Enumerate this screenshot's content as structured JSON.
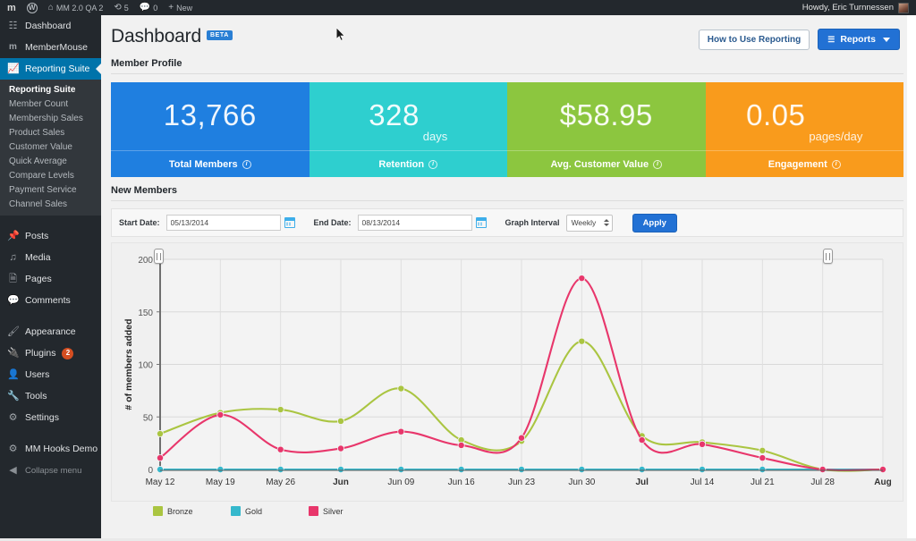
{
  "adminbar": {
    "logo": "m",
    "wp_icon": "wordpress-icon",
    "site_name": "MM 2.0 QA 2",
    "updates_count": "5",
    "comments_count": "0",
    "new_label": "New",
    "howdy": "Howdy, Eric Turnnessen"
  },
  "sidebar": {
    "items": [
      {
        "label": "Dashboard",
        "icon": "dashboard-icon",
        "active": false
      },
      {
        "label": "MemberMouse",
        "icon": "membermouse-icon",
        "active": false
      },
      {
        "label": "Reporting Suite",
        "icon": "chart-bar-icon",
        "active": true
      }
    ],
    "submenu": [
      {
        "label": "Reporting Suite",
        "current": true
      },
      {
        "label": "Member Count",
        "current": false
      },
      {
        "label": "Membership Sales",
        "current": false
      },
      {
        "label": "Product Sales",
        "current": false
      },
      {
        "label": "Customer Value",
        "current": false
      },
      {
        "label": "Quick Average",
        "current": false
      },
      {
        "label": "Compare Levels",
        "current": false
      },
      {
        "label": "Payment Service",
        "current": false
      },
      {
        "label": "Channel Sales",
        "current": false
      }
    ],
    "group2": [
      {
        "label": "Posts",
        "icon": "pin-icon"
      },
      {
        "label": "Media",
        "icon": "media-icon"
      },
      {
        "label": "Pages",
        "icon": "pages-icon"
      },
      {
        "label": "Comments",
        "icon": "comment-icon"
      }
    ],
    "group3": [
      {
        "label": "Appearance",
        "icon": "brush-icon",
        "badge": ""
      },
      {
        "label": "Plugins",
        "icon": "plug-icon",
        "badge": "2"
      },
      {
        "label": "Users",
        "icon": "users-icon",
        "badge": ""
      },
      {
        "label": "Tools",
        "icon": "wrench-icon",
        "badge": ""
      },
      {
        "label": "Settings",
        "icon": "settings-icon",
        "badge": ""
      }
    ],
    "group4": [
      {
        "label": "MM Hooks Demo",
        "icon": "gear-icon"
      }
    ],
    "collapse": {
      "label": "Collapse menu",
      "icon": "collapse-icon"
    }
  },
  "header": {
    "title": "Dashboard",
    "badge": "BETA",
    "how_to_button": "How to Use Reporting",
    "reports_button": "Reports"
  },
  "member_profile": {
    "section_title": "Member Profile",
    "tiles": [
      {
        "value": "13,766",
        "unit": "",
        "label": "Total Members",
        "color": "#1f7fe0"
      },
      {
        "value": "328",
        "unit": "days",
        "label": "Retention",
        "color": "#2ecfcf"
      },
      {
        "value": "$58.95",
        "unit": "",
        "label": "Avg. Customer Value",
        "color": "#8cc63f"
      },
      {
        "value": "0.05",
        "unit": "pages/day",
        "label": "Engagement",
        "color": "#f99b1c"
      }
    ]
  },
  "new_members": {
    "section_title": "New Members",
    "start_date_label": "Start Date:",
    "start_date_value": "05/13/2014",
    "end_date_label": "End Date:",
    "end_date_value": "08/13/2014",
    "graph_interval_label": "Graph Interval",
    "graph_interval_value": "Weekly",
    "apply_label": "Apply"
  },
  "chart_data": {
    "type": "line",
    "title": "New Members",
    "xlabel": "",
    "ylabel": "# of members added",
    "ylim": [
      0,
      200
    ],
    "yticks": [
      0,
      50,
      100,
      150,
      200
    ],
    "grid": true,
    "legend_position": "bottom-left",
    "categories": [
      "May 12",
      "May 19",
      "May 26",
      "Jun",
      "Jun 09",
      "Jun 16",
      "Jun 23",
      "Jun 30",
      "Jul",
      "Jul 14",
      "Jul 21",
      "Jul 28",
      "Aug"
    ],
    "bold_categories": [
      "Jun",
      "Jul",
      "Aug"
    ],
    "series": [
      {
        "name": "Bronze",
        "color": "#aac541",
        "values": [
          34,
          54,
          57,
          46,
          77,
          28,
          27,
          122,
          32,
          26,
          18,
          0,
          0
        ]
      },
      {
        "name": "Gold",
        "color": "#35b8cc",
        "values": [
          0,
          0,
          0,
          0,
          0,
          0,
          0,
          0,
          0,
          0,
          0,
          0,
          0
        ]
      },
      {
        "name": "Silver",
        "color": "#e8366b",
        "values": [
          11,
          52,
          19,
          20,
          36,
          23,
          30,
          182,
          28,
          24,
          11,
          0,
          0
        ]
      }
    ]
  }
}
